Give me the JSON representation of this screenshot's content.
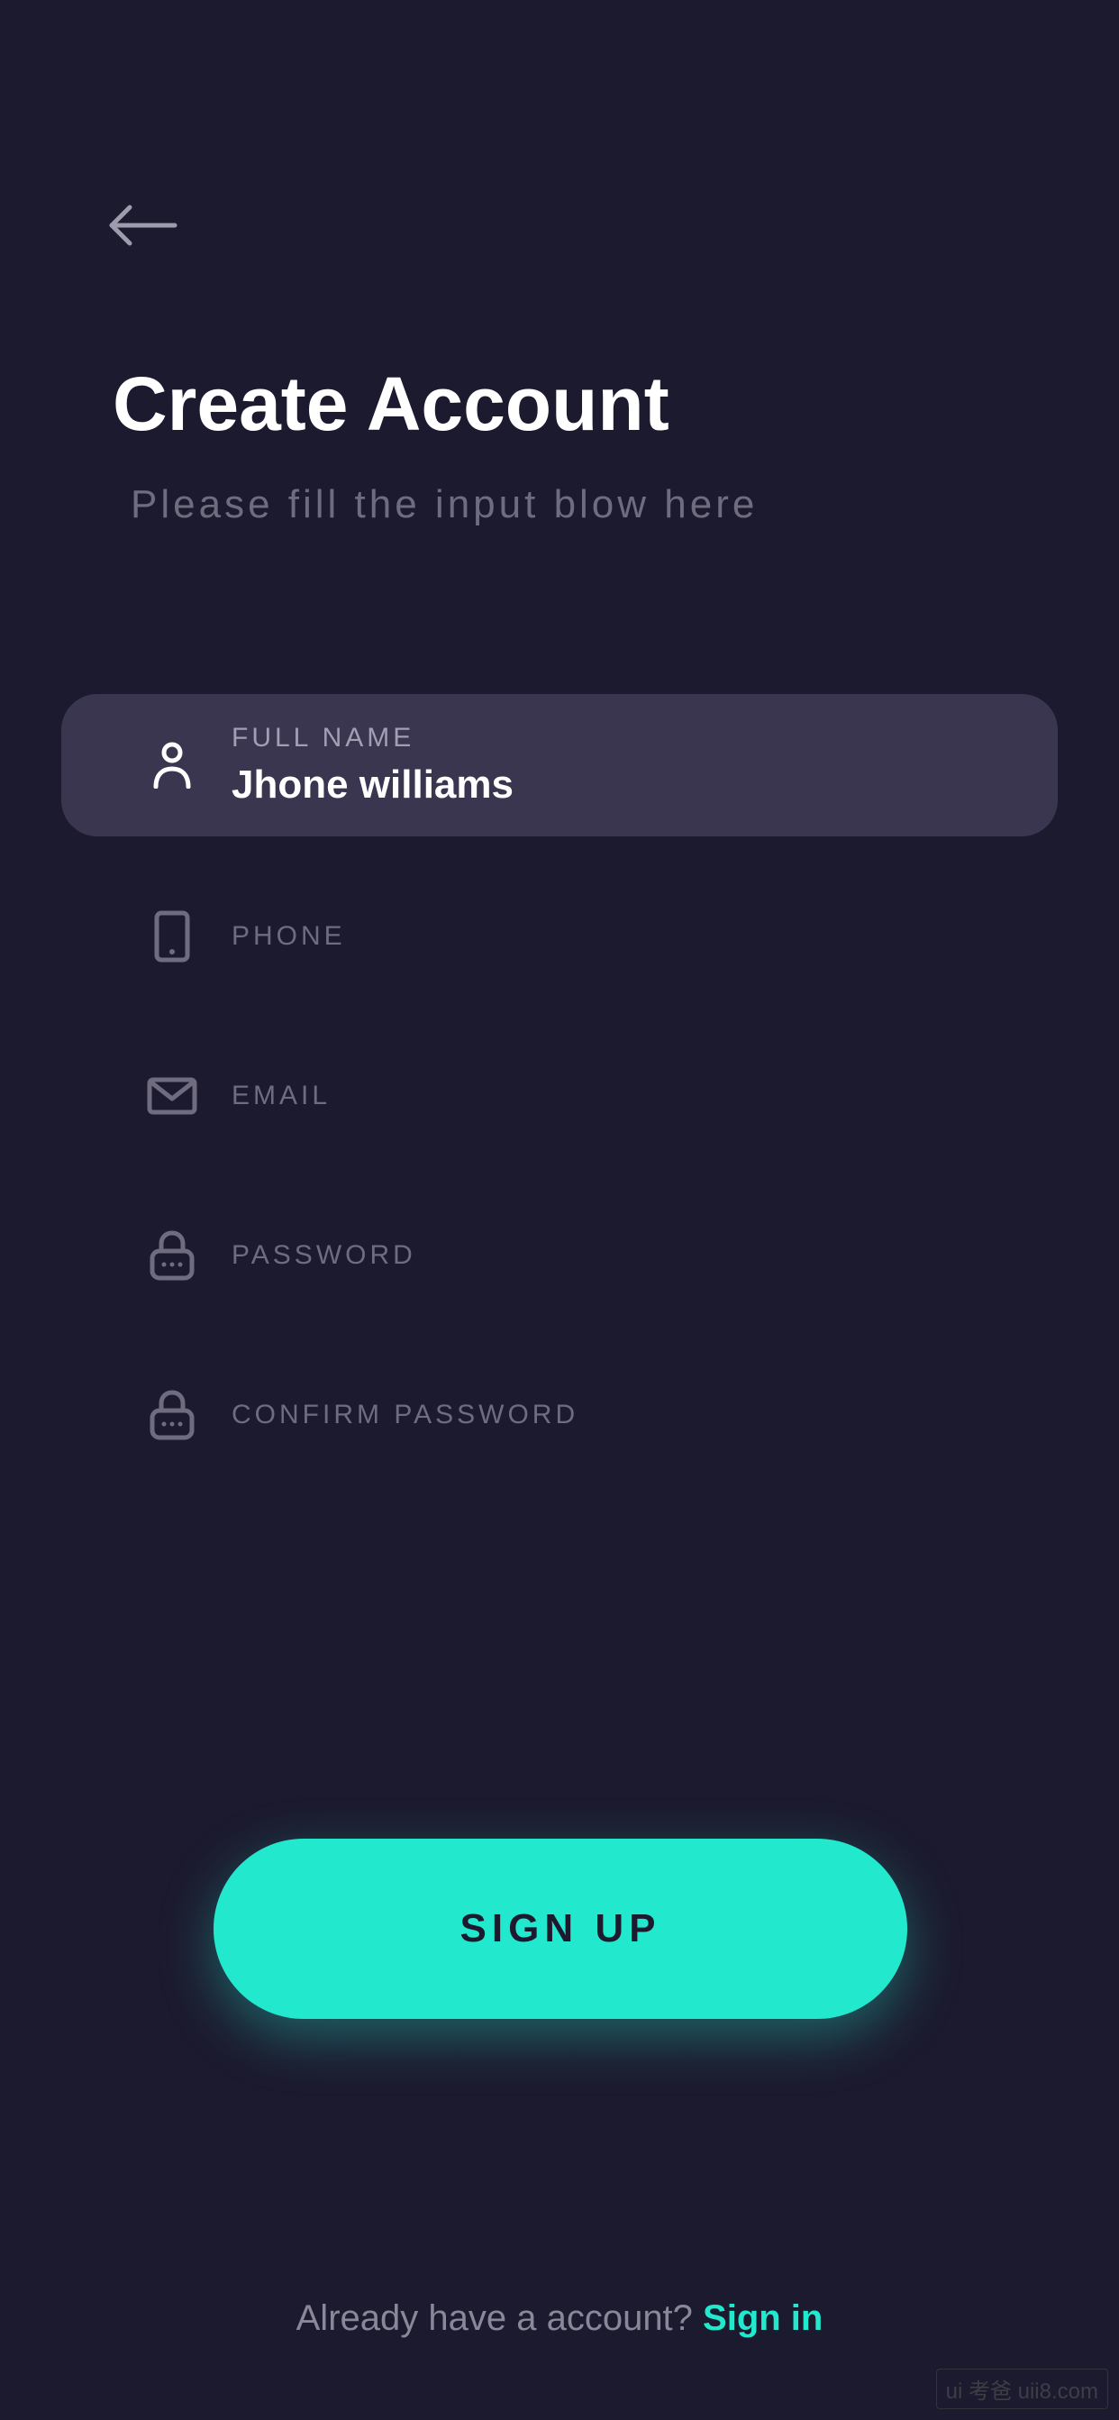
{
  "header": {
    "title": "Create Account",
    "subtitle": "Please fill the input blow here"
  },
  "fields": {
    "fullname": {
      "label": "FULL NAME",
      "value": "Jhone williams"
    },
    "phone": {
      "label": "PHONE"
    },
    "email": {
      "label": "EMAIL"
    },
    "password": {
      "label": "PASSWORD"
    },
    "confirmPassword": {
      "label": "CONFIRM PASSWORD"
    }
  },
  "actions": {
    "signup": "SIGN UP"
  },
  "footer": {
    "prompt": "Already have a account? ",
    "link": "Sign in"
  },
  "watermark": "ui 考爸 uii8.com"
}
